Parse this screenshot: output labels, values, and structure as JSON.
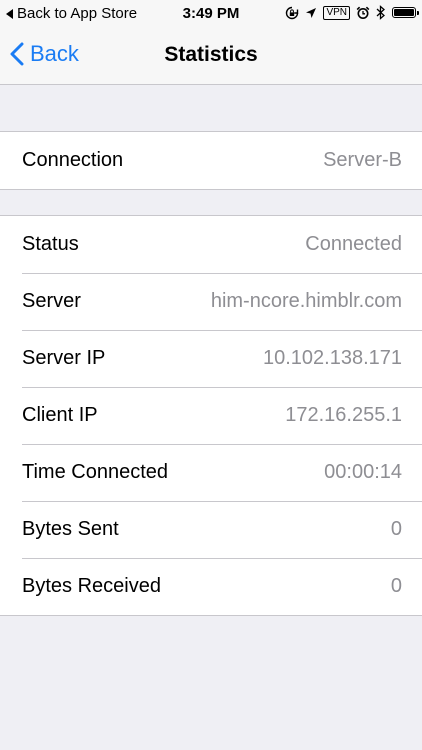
{
  "status_bar": {
    "back_label": "Back to App Store",
    "time": "3:49 PM",
    "vpn_label": "VPN"
  },
  "nav": {
    "back_label": "Back",
    "title": "Statistics"
  },
  "connection_group": {
    "rows": [
      {
        "label": "Connection",
        "value": "Server-B"
      }
    ]
  },
  "stats_group": {
    "rows": [
      {
        "label": "Status",
        "value": "Connected"
      },
      {
        "label": "Server",
        "value": "him-ncore.himblr.com"
      },
      {
        "label": "Server IP",
        "value": "10.102.138.171"
      },
      {
        "label": "Client IP",
        "value": "172.16.255.1"
      },
      {
        "label": "Time Connected",
        "value": "00:00:14"
      },
      {
        "label": "Bytes Sent",
        "value": "0"
      },
      {
        "label": "Bytes Received",
        "value": "0"
      }
    ]
  },
  "icons": {
    "back_to_app": "triangle-left-icon",
    "rotation_lock": "rotation-lock-icon",
    "location": "location-arrow-icon",
    "alarm": "alarm-icon",
    "bluetooth": "bluetooth-icon",
    "battery": "battery-icon",
    "nav_back": "chevron-left-icon"
  },
  "colors": {
    "accent": "#1a7cf4",
    "value_text": "#8e8e93",
    "background": "#efeff4",
    "separator": "#c8c7cc"
  }
}
